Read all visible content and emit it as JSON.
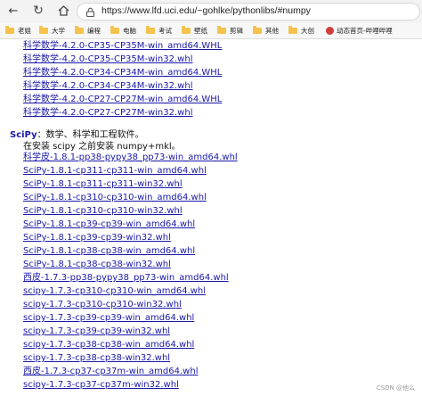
{
  "browser": {
    "url": "https://www.lfd.uci.edu/~gohlke/pythonlibs/#numpy",
    "bookmarks": [
      {
        "label": "老姐",
        "icon": "folder-icon"
      },
      {
        "label": "大学",
        "icon": "folder-icon"
      },
      {
        "label": "编程",
        "icon": "folder-icon"
      },
      {
        "label": "电脑",
        "icon": "folder-icon"
      },
      {
        "label": "考试",
        "icon": "folder-icon"
      },
      {
        "label": "壁纸",
        "icon": "folder-icon"
      },
      {
        "label": "剪辑",
        "icon": "folder-icon"
      },
      {
        "label": "其他",
        "icon": "folder-icon"
      },
      {
        "label": "大创",
        "icon": "folder-icon"
      },
      {
        "label": "动态首页-哔哩哔哩",
        "icon": "bilibili-icon"
      }
    ]
  },
  "numpy_links": [
    "科学数学-4.2.0-CP35-CP35M-win_amd64.WHL",
    "科学数学-4.2.0-CP35-CP35M-win32.whl",
    "科学数学-4.2.0-CP34-CP34M-win_amd64.WHL",
    "科学数学-4.2.0-CP34-CP34M-win32.whl",
    "科学数学-4.2.0-CP27-CP27M-win_amd64.WHL",
    "科学数学-4.2.0-CP27-CP27M-win32.whl"
  ],
  "scipy_section": {
    "name": "SciPy",
    "description": "：数学、科学和工程软件。",
    "note": "在安装 scipy 之前安装 numpy+mkl。",
    "links": [
      "科学皮-1.8.1-pp38-pypy38_pp73-win_amd64.whl",
      "SciPy-1.8.1-cp311-cp311-win_amd64.whl",
      "SciPy-1.8.1-cp311-cp311-win32.whl",
      "SciPy-1.8.1-cp310-cp310-win_amd64.whl",
      "SciPy-1.8.1-cp310-cp310-win32.whl",
      "SciPy-1.8.1-cp39-cp39-win_amd64.whl",
      "SciPy-1.8.1-cp39-cp39-win32.whl",
      "SciPy-1.8.1-cp38-cp38-win_amd64.whl",
      "SciPy-1.8.1-cp38-cp38-win32.whl",
      "西皮-1.7.3-pp38-pypy38_pp73-win_amd64.whl",
      "scipy-1.7.3-cp310-cp310-win_amd64.whl",
      "scipy-1.7.3-cp310-cp310-win32.whl",
      "scipy-1.7.3-cp39-cp39-win_amd64.whl",
      "scipy-1.7.3-cp39-cp39-win32.whl",
      "scipy-1.7.3-cp38-cp38-win_amd64.whl",
      "scipy-1.7.3-cp38-cp38-win32.whl",
      "西皮-1.7.3-cp37-cp37m-win_amd64.whl",
      "scipy-1.7.3-cp37-cp37m-win32.whl"
    ]
  },
  "watermark": "CSDN @他么"
}
